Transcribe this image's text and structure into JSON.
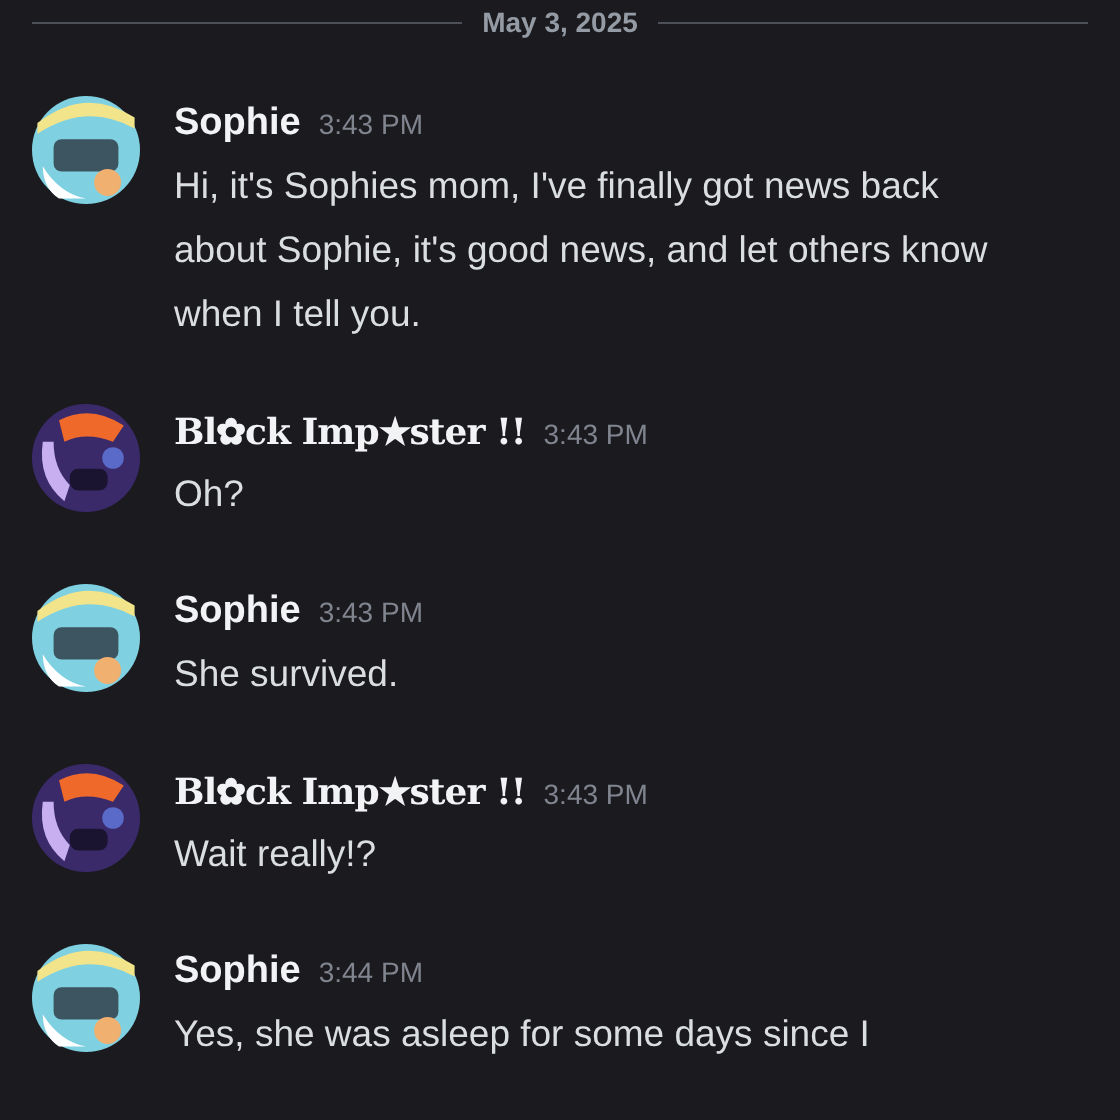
{
  "date_divider": "May 3, 2025",
  "messages": [
    {
      "kind": "plain",
      "author": "Sophie",
      "time": "3:43 PM",
      "text": "Hi, it's Sophies mom, I've finally got news back about Sophie, it's good news, and let others know when I tell you."
    },
    {
      "kind": "fancy",
      "author": "Bl✿ck Imp★ster !!",
      "time": "3:43 PM",
      "text": "Oh?"
    },
    {
      "kind": "plain",
      "author": "Sophie",
      "time": "3:43 PM",
      "text": "She survived."
    },
    {
      "kind": "fancy",
      "author": "Bl✿ck Imp★ster !!",
      "time": "3:43 PM",
      "text": "Wait really!?"
    },
    {
      "kind": "plain",
      "author": "Sophie",
      "time": "3:44 PM",
      "text": "Yes, she was asleep for some days since I"
    }
  ]
}
